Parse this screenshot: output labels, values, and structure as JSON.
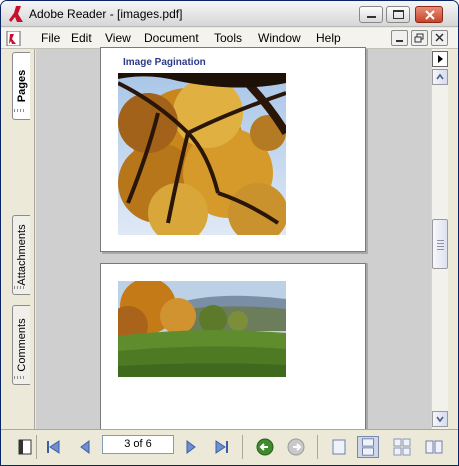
{
  "window": {
    "title": "Adobe Reader - [images.pdf]"
  },
  "menu": {
    "items": [
      "File",
      "Edit",
      "View",
      "Document",
      "Tools",
      "Window",
      "Help"
    ]
  },
  "navigation_tabs": {
    "pages": "Pages",
    "attachments": "Attachments",
    "comments": "Comments"
  },
  "document": {
    "page1_heading": "Image Pagination",
    "images": [
      {
        "icon": "autumn-tree-photo"
      },
      {
        "icon": "autumn-meadow-photo"
      }
    ]
  },
  "statusbar": {
    "page_indicator": "3 of 6"
  },
  "icons": {
    "first_page": "first-page-icon",
    "previous_page": "previous-page-icon",
    "next_page": "next-page-icon",
    "last_page": "last-page-icon",
    "go_back": "back-icon",
    "go_forward": "forward-icon",
    "single_page": "single-page-layout-icon",
    "continuous": "continuous-layout-icon",
    "facing": "facing-layout-icon",
    "continuous_facing": "continuous-facing-layout-icon"
  },
  "colors": {
    "heading": "#2b3a86",
    "back_button": "#3f8a2c",
    "close_button": "#c8442a"
  }
}
